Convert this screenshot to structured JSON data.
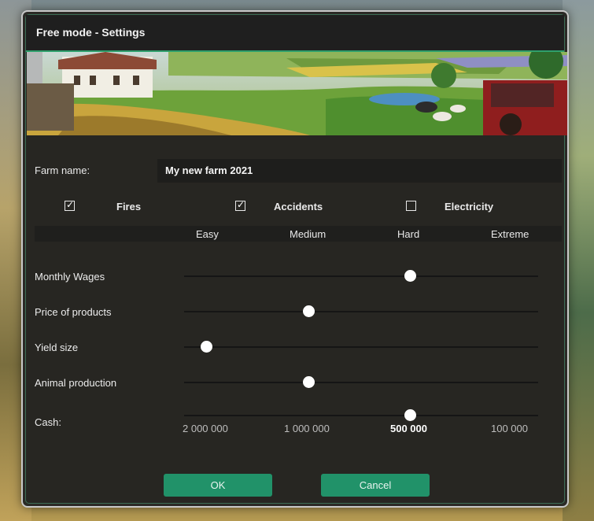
{
  "dialog": {
    "title": "Free mode - Settings"
  },
  "farm_name": {
    "label": "Farm name:",
    "value": "My new farm 2021"
  },
  "options": [
    {
      "label": "Fires",
      "checked": true
    },
    {
      "label": "Accidents",
      "checked": true
    },
    {
      "label": "Electricity",
      "checked": false
    }
  ],
  "difficulty_levels": [
    "Easy",
    "Medium",
    "Hard",
    "Extreme"
  ],
  "sliders": [
    {
      "label": "Monthly Wages",
      "level": "Hard"
    },
    {
      "label": "Price of products",
      "level": "Medium"
    },
    {
      "label": "Yield size",
      "level": "Easy"
    },
    {
      "label": "Animal production",
      "level": "Medium"
    },
    {
      "label": "Cash:",
      "level": "Hard"
    }
  ],
  "cash_values": [
    "2 000 000",
    "1 000 000",
    "500 000",
    "100 000"
  ],
  "cash_selected": "500 000",
  "buttons": {
    "ok": "OK",
    "cancel": "Cancel"
  },
  "colors": {
    "accent": "#219269",
    "title_bar": "#1f1f1f",
    "panel": "#2b2a26"
  }
}
